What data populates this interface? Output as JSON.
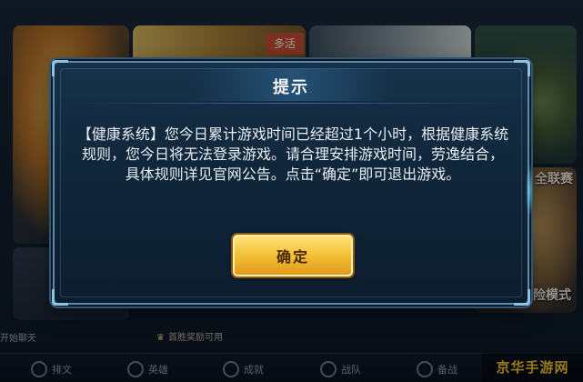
{
  "background": {
    "tag_left": "多活",
    "mode_right_1": "全联赛",
    "mode_right_2": "险模式",
    "strip_left": "开始聊天",
    "strip_mid": "首胜奖励可用",
    "nav": [
      {
        "label": "排文",
        "icon": "chat-icon"
      },
      {
        "label": "英雄",
        "icon": "hero-icon"
      },
      {
        "label": "成就",
        "icon": "achievement-icon"
      },
      {
        "label": "战队",
        "icon": "team-icon"
      },
      {
        "label": "备战",
        "icon": "prepare-icon"
      }
    ],
    "watermark": "京华手游网"
  },
  "dialog": {
    "title": "提示",
    "message": "【健康系统】您今日累计游戏时间已经超过1个小时，根据健康系统规则，您今日将无法登录游戏。请合理安排游戏时间，劳逸结合，具体规则详见官网公告。点击“确定”即可退出游戏。",
    "confirm_label": "确定"
  },
  "colors": {
    "dialog_bg": "#10263a",
    "dialog_border": "#5e89a8",
    "button_gold": "#f5c33a",
    "watermark": "#f0c12a"
  }
}
